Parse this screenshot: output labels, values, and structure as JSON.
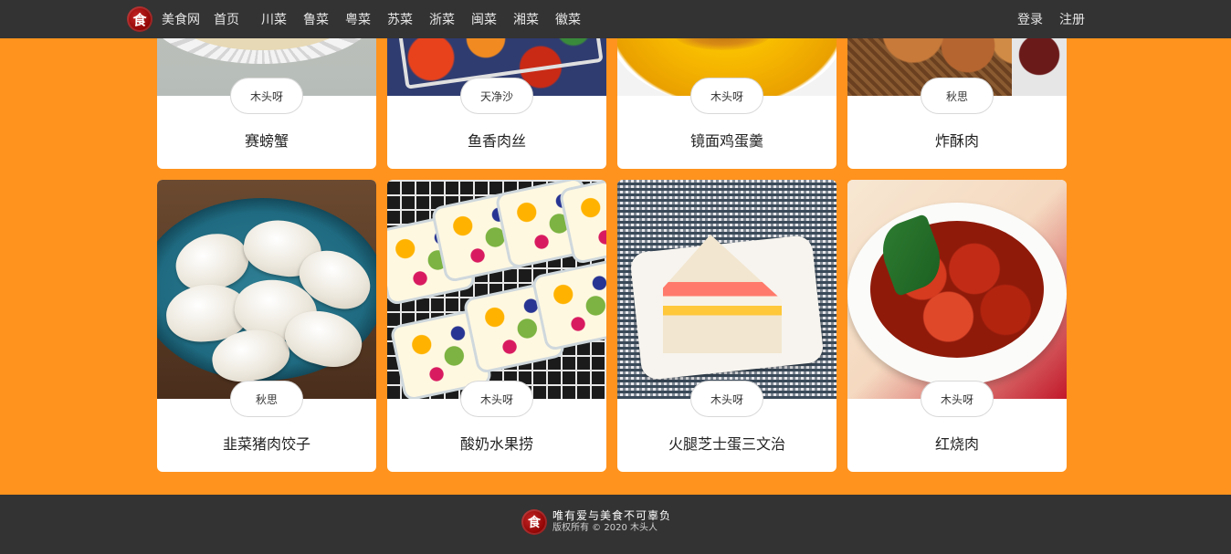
{
  "navbar": {
    "logo_char": "食",
    "brand": "美食网",
    "links": [
      "首页",
      "川菜",
      "鲁菜",
      "粤菜",
      "苏菜",
      "浙菜",
      "闽菜",
      "湘菜",
      "徽菜"
    ],
    "login": "登录",
    "register": "注册"
  },
  "recipes": [
    {
      "author": "木头呀",
      "title": "赛螃蟹"
    },
    {
      "author": "天净沙",
      "title": "鱼香肉丝"
    },
    {
      "author": "木头呀",
      "title": "镜面鸡蛋羹"
    },
    {
      "author": "秋思",
      "title": "炸酥肉"
    },
    {
      "author": "秋思",
      "title": "韭菜猪肉饺子"
    },
    {
      "author": "木头呀",
      "title": "酸奶水果捞"
    },
    {
      "author": "木头呀",
      "title": "火腿芝士蛋三文治"
    },
    {
      "author": "木头呀",
      "title": "红烧肉"
    }
  ],
  "footer": {
    "logo_char": "食",
    "slogan": "唯有爱与美食不可辜负",
    "copyright": "版权所有 © 2020 木头人"
  },
  "colors": {
    "background": "#ff931e",
    "navbar": "#333333",
    "footer": "#333333",
    "card": "#ffffff"
  }
}
